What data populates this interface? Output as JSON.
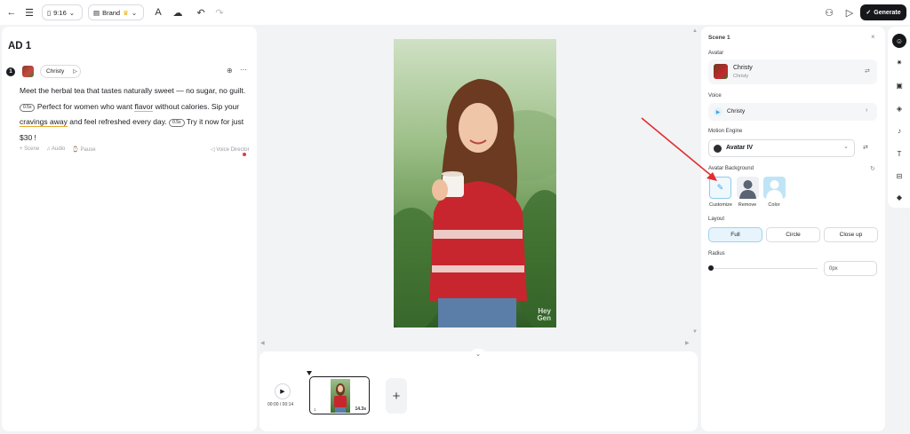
{
  "topbar": {
    "aspect_label": "9:16",
    "brand_label": "Brand",
    "generate_label": "Generate"
  },
  "editor": {
    "title": "AD 1",
    "scene_number": "1",
    "voice_chip": "Christy",
    "script": {
      "p1": "Meet the herbal tea that tastes naturally sweet — no sugar, no guilt.",
      "pause1": "0.5s",
      "p2": "Perfect for women who want",
      "w_flavor": "flavor",
      "p3": "without calories. Sip your",
      "w_cravings": "cravings away",
      "p4": "and feel refreshed every day.",
      "pause2": "0.5s",
      "p5": "Try it now for just $30 !"
    },
    "tools": {
      "scene": "+ Scene",
      "audio": "Audio",
      "pause": "Pause",
      "voice_director": "Voice Director"
    }
  },
  "canvas": {
    "watermark_line1": "Hey",
    "watermark_line2": "Gen"
  },
  "timeline": {
    "time": "00:00 / 00:14",
    "clip_index": "1",
    "clip_duration": "14.3s"
  },
  "properties": {
    "title": "Scene 1",
    "avatar_label": "Avatar",
    "avatar_name": "Christy",
    "avatar_sub": "Christy",
    "voice_label": "Voice",
    "voice_name": "Christy",
    "motion_label": "Motion Engine",
    "motion_value": "Avatar IV",
    "bg_label": "Avatar Background",
    "bg_options": {
      "customize": "Customize",
      "remove": "Remove",
      "color": "Color"
    },
    "layout_label": "Layout",
    "layout_options": {
      "full": "Full",
      "circle": "Circle",
      "closeup": "Close up"
    },
    "radius_label": "Radius",
    "radius_value": "0px"
  },
  "colors": {
    "accent": "#3ea6e6",
    "annotation_arrow": "#e03030",
    "primary_dark": "#16171a"
  }
}
